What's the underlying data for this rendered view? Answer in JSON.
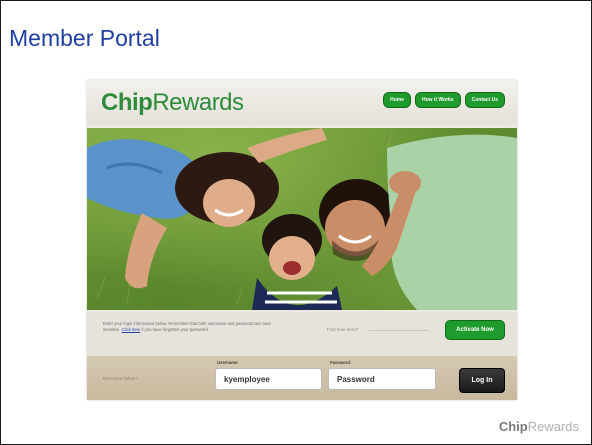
{
  "slide": {
    "title": "Member Portal",
    "footer_logo_bold": "Chip",
    "footer_logo_light": "Rewards"
  },
  "site": {
    "brand_bold": "Chip",
    "brand_rest": "Rewards",
    "nav": [
      "Home",
      "How it Works",
      "Contact Us"
    ],
    "hero_alt": "family-lying-on-grass-photo",
    "info_text_before": "Enter your login information below. Remember that both username and password are case sensitive.",
    "info_link": "Click here",
    "info_text_after": " if you have forgotten your password.",
    "first_time_label": "First time here?",
    "activate_label": "Activate Now",
    "been_here_label": "Been here before?",
    "username_label": "Username:",
    "username_value": "kyemployee",
    "password_label": "Password:",
    "password_value": "Password",
    "login_label": "Log In"
  },
  "colors": {
    "title": "#1f3fa0",
    "brand_green": "#2e8c3a",
    "button_green": "#1f9a2c",
    "login_dark": "#1b1b1b"
  }
}
